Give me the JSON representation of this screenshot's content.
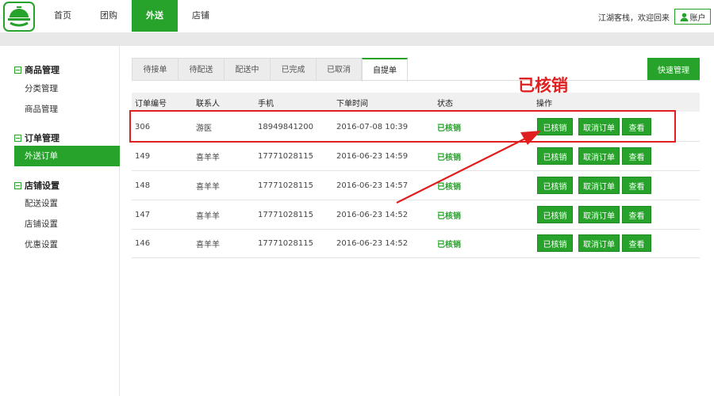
{
  "header": {
    "nav": [
      "首页",
      "团购",
      "外送",
      "店铺"
    ],
    "active_nav": 2,
    "welcome": "江湖客栈，欢迎回来",
    "account_label": "账户"
  },
  "sidebar": {
    "groups": [
      {
        "title": "商品管理",
        "items": [
          "分类管理",
          "商品管理"
        ]
      },
      {
        "title": "订单管理",
        "items": [
          "外送订单"
        ]
      },
      {
        "title": "店铺设置",
        "items": [
          "配送设置",
          "店铺设置",
          "优惠设置"
        ]
      }
    ],
    "active_item": "外送订单"
  },
  "tabs": [
    "待接单",
    "待配送",
    "配送中",
    "已完成",
    "已取消",
    "自提单"
  ],
  "active_tab": 5,
  "quick_manage_label": "快速管理",
  "table": {
    "columns": [
      "订单编号",
      "联系人",
      "手机",
      "下单时间",
      "状态",
      "操作"
    ],
    "rows": [
      {
        "id": "306",
        "contact": "游医",
        "phone": "18949841200",
        "time": "2016-07-08 10:39",
        "status": "已核销"
      },
      {
        "id": "149",
        "contact": "喜羊羊",
        "phone": "17771028115",
        "time": "2016-06-23 14:59",
        "status": "已核销"
      },
      {
        "id": "148",
        "contact": "喜羊羊",
        "phone": "17771028115",
        "time": "2016-06-23 14:57",
        "status": "已核销"
      },
      {
        "id": "147",
        "contact": "喜羊羊",
        "phone": "17771028115",
        "time": "2016-06-23 14:52",
        "status": "已核销"
      },
      {
        "id": "146",
        "contact": "喜羊羊",
        "phone": "17771028115",
        "time": "2016-06-23 14:52",
        "status": "已核销"
      }
    ],
    "actions": [
      "已核销",
      "取消订单",
      "查看"
    ]
  },
  "annotation": {
    "text": "已核销",
    "color": "#e02020"
  },
  "colors": {
    "accent": "#27a22b",
    "annotation": "#e02020"
  }
}
